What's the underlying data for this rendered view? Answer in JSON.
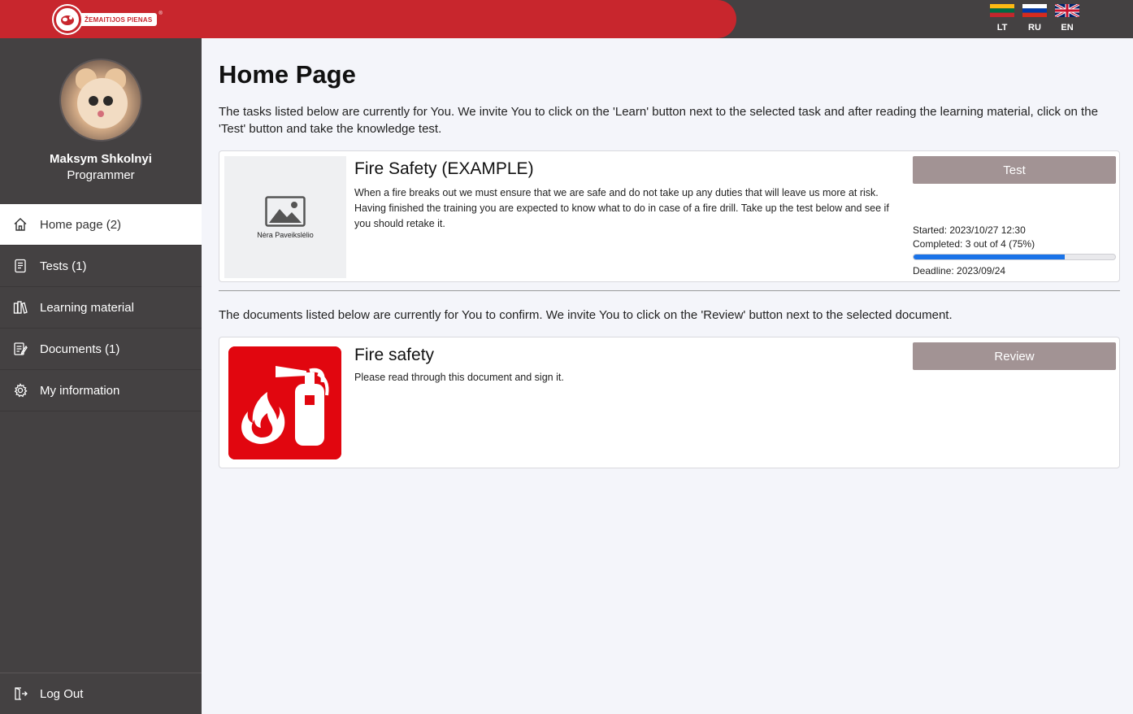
{
  "brand": {
    "name": "ŽEMAITIJOS PIENAS",
    "colors": {
      "primary": "#c8262d",
      "dark": "#444142",
      "button": "#a29394",
      "progress": "#1a73e8"
    }
  },
  "languages": [
    {
      "code": "LT",
      "flag": "lithuania-flag-icon"
    },
    {
      "code": "RU",
      "flag": "russia-flag-icon"
    },
    {
      "code": "EN",
      "flag": "uk-flag-icon"
    }
  ],
  "user": {
    "name": "Maksym Shkolnyi",
    "role": "Programmer"
  },
  "nav": {
    "items": [
      {
        "label": "Home page (2)",
        "icon": "home-icon",
        "active": true
      },
      {
        "label": "Tests (1)",
        "icon": "tests-icon",
        "active": false
      },
      {
        "label": "Learning material",
        "icon": "books-icon",
        "active": false
      },
      {
        "label": "Documents (1)",
        "icon": "document-icon",
        "active": false
      },
      {
        "label": "My information",
        "icon": "gear-icon",
        "active": false
      }
    ],
    "logout": "Log Out"
  },
  "main": {
    "title": "Home Page",
    "tasks_intro": "The tasks listed below are currently for You. We invite You to click on the 'Learn' button next to the selected task and after reading the learning material, click on the 'Test' button and take the knowledge test.",
    "task": {
      "image_caption": "Nėra Paveikslėlio",
      "title": "Fire Safety (EXAMPLE)",
      "description": "When a fire breaks out we must ensure that we are safe and do not take up any duties that will leave us more at risk. Having finished the training you are expected to know what to do in case of a fire drill. Take up the test below and see if you should retake it.",
      "button": "Test",
      "started": "Started: 2023/10/27 12:30",
      "completed": "Completed: 3 out of 4 (75%)",
      "progress_fraction": 0.75,
      "deadline": "Deadline: 2023/09/24"
    },
    "docs_intro": "The documents listed below are currently for You to confirm. We invite You to click on the 'Review' button next to the selected document.",
    "document": {
      "image": "fire-extinguisher-icon",
      "title": "Fire safety",
      "description": "Please read through this document and sign it.",
      "button": "Review"
    }
  }
}
